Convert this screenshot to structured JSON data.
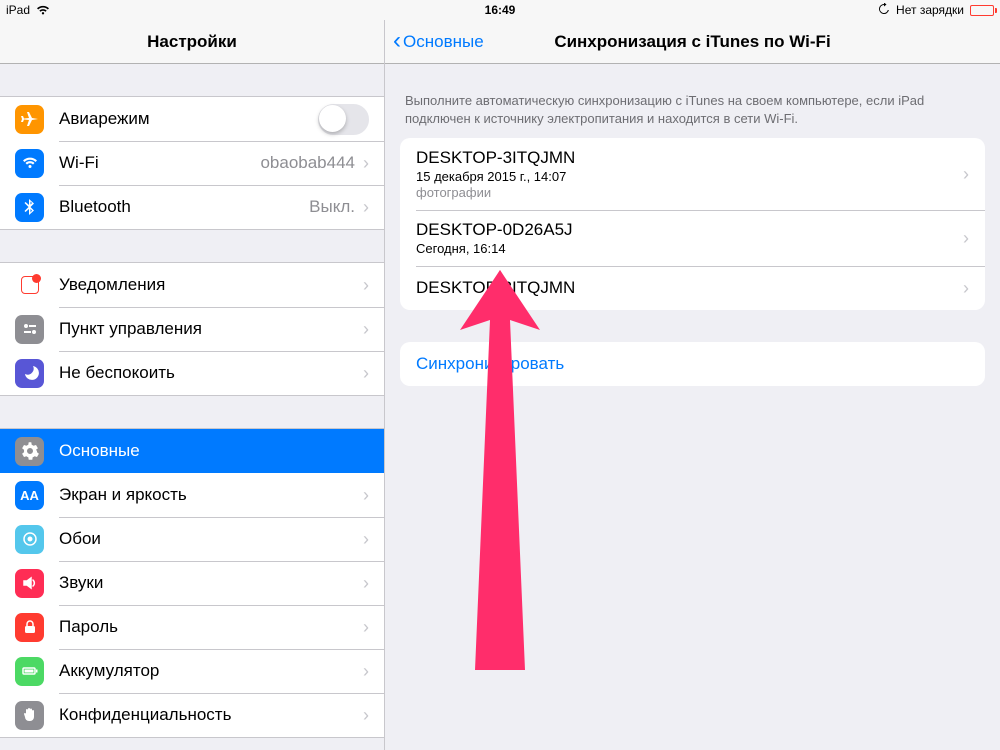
{
  "statusbar": {
    "device": "iPad",
    "time": "16:49",
    "charging_text": "Нет зарядки"
  },
  "sidebar": {
    "title": "Настройки",
    "groups": [
      [
        {
          "id": "airplane",
          "label": "Авиарежим",
          "type": "switch"
        },
        {
          "id": "wifi",
          "label": "Wi-Fi",
          "detail": "obaobab444",
          "disclosure": true
        },
        {
          "id": "bluetooth",
          "label": "Bluetooth",
          "detail": "Выкл.",
          "disclosure": true
        }
      ],
      [
        {
          "id": "notifications",
          "label": "Уведомления",
          "disclosure": true
        },
        {
          "id": "control-center",
          "label": "Пункт управления",
          "disclosure": true
        },
        {
          "id": "dnd",
          "label": "Не беспокоить",
          "disclosure": true
        }
      ],
      [
        {
          "id": "general",
          "label": "Основные",
          "selected": true,
          "disclosure": true
        },
        {
          "id": "display",
          "label": "Экран и яркость",
          "disclosure": true
        },
        {
          "id": "wallpaper",
          "label": "Обои",
          "disclosure": true
        },
        {
          "id": "sounds",
          "label": "Звуки",
          "disclosure": true
        },
        {
          "id": "passcode",
          "label": "Пароль",
          "disclosure": true
        },
        {
          "id": "battery",
          "label": "Аккумулятор",
          "disclosure": true
        },
        {
          "id": "privacy",
          "label": "Конфиденциальность",
          "disclosure": true
        }
      ]
    ]
  },
  "content": {
    "back_label": "Основные",
    "title": "Синхронизация с iTunes по Wi-Fi",
    "description": "Выполните автоматическую синхронизацию с iTunes на своем компьютере, если iPad подключен к источнику электропитания и находится в сети Wi-Fi.",
    "computers": [
      {
        "name": "DESKTOP-3ITQJMN",
        "sub": "15 декабря 2015 г., 14:07",
        "sub2": "фотографии"
      },
      {
        "name": "DESKTOP-0D26A5J",
        "sub": "Сегодня, 16:14"
      },
      {
        "name": "DESKTOP-3ITQJMN"
      }
    ],
    "sync_button": "Синхронизировать"
  }
}
